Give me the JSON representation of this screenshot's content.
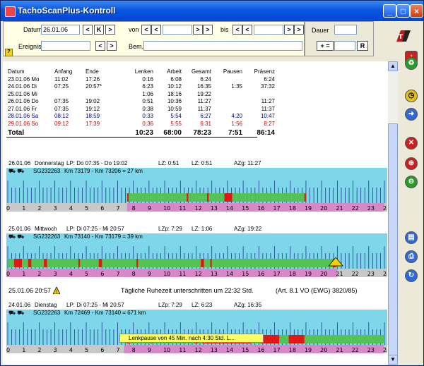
{
  "window": {
    "title": "TachoScanPlus-Kontroll"
  },
  "titlebar_buttons": {
    "minimize": "_",
    "maximize": "□",
    "close": "×"
  },
  "form": {
    "datum_label": "Datum",
    "datum_value": "26.01.06",
    "datum_btn_prev": "<",
    "datum_btn_k": "K",
    "datum_btn_next": ">",
    "ereignis_label": "Ereignis",
    "ereignis_value": "",
    "von_label": "von",
    "bis_label": "bis",
    "bem_label": "Bem.",
    "bem_value": "",
    "dauer_label": "Dauer",
    "dauer_value": "",
    "plus_label": "+ =",
    "r_label": "R"
  },
  "summary": {
    "headers": [
      "Datum",
      "Anfang",
      "Ende",
      "Lenken",
      "Arbeit",
      "Gesamt",
      "Pausen",
      "Präsenz"
    ],
    "rows": [
      [
        "23.01.06 Mo",
        "11:02",
        "17:26",
        "0:16",
        "6:08",
        "6:24",
        "",
        "6:24"
      ],
      [
        "24.01.06 Di",
        "07:25",
        "20:57*",
        "6:23",
        "10:12",
        "16:35",
        "1:35",
        "37:32"
      ],
      [
        "25.01.06 Mi",
        "",
        "",
        "1:06",
        "18:16",
        "19:22",
        "",
        ""
      ],
      [
        "26.01.06 Do",
        "07:35",
        "19:02",
        "0:51",
        "10:36",
        "11:27",
        "",
        "11:27"
      ],
      [
        "27.01.06 Fr",
        "07:35",
        "19:12",
        "0:38",
        "10:59",
        "11:37",
        "",
        "11:37"
      ],
      [
        "28.01.06 Sa",
        "08:12",
        "18:59",
        "0:33",
        "5:54",
        "6:27",
        "4:20",
        "10:47"
      ],
      [
        "29.01.06 So",
        "09:12",
        "17:39",
        "0:36",
        "5:55",
        "6:31",
        "1:56",
        "8:27"
      ]
    ],
    "total": [
      "Total",
      "",
      "",
      "10:23",
      "68:00",
      "78:23",
      "7:51",
      "86:14"
    ],
    "row_colors": [
      "#000000",
      "#000000",
      "#000000",
      "#000000",
      "#000000",
      "#000080",
      "#c00000"
    ]
  },
  "days": [
    {
      "date": "26.01.06",
      "weekday": "Donnerstag",
      "lp": "LP: Do 07:35 - Do 19:02",
      "lz": "LZ: 0:51",
      "lz2": "LZ: 0:51",
      "azg": "AZg: 11:27",
      "vehicle": "SG232263",
      "km": "Km 73179 - Km 73206 = 27 km"
    },
    {
      "date": "25.01.06",
      "weekday": "Mittwoch",
      "lp": "LP: Di 07:25 - Mi 20:57",
      "lz": "LZp: 7:29",
      "lz2": "LZ: 1:06",
      "azg": "AZg: 19:22",
      "vehicle": "SG232263",
      "km": "Km 73140 - Km 73179 = 39 km"
    },
    {
      "date": "24.01.06",
      "weekday": "Dienstag",
      "lp": "LP: Di 07:25 - Mi 20:57",
      "lz": "LZp: 7:29",
      "lz2": "LZ: 6:23",
      "azg": "AZg: 16:35",
      "vehicle": "SG232263",
      "km": "Km 72469 - Km 73140 = 671 km"
    }
  ],
  "warning": {
    "datetime": "25.01.06 20:57",
    "text": "Tägliche Ruhezeit unterschritten um 22:32 Std.",
    "ref": "(Art. 8.1 VO (EWG) 3820/85)"
  },
  "tooltip": "Lenkpause von 45 Min. nach 4:30 Std. L...",
  "axis_ticks": [
    "0",
    "1",
    "2",
    "3",
    "4",
    "5",
    "6",
    "7",
    "8",
    "9",
    "10",
    "11",
    "12",
    "13",
    "14",
    "15",
    "16",
    "17",
    "18",
    "19",
    "20",
    "21",
    "22",
    "23",
    "24"
  ],
  "side_buttons": [
    "arrow-up-icon",
    "recycle-icon",
    "clock-icon",
    "forward-icon",
    "delete-icon",
    "zoom-in-icon",
    "zoom-out-icon",
    "archive-icon",
    "print-icon",
    "refresh-icon"
  ],
  "colors": {
    "green": "#55c255",
    "pink": "#d887c8",
    "red": "#e01818",
    "cyan": "#7dd6ea",
    "gray": "#c8c8c8"
  }
}
